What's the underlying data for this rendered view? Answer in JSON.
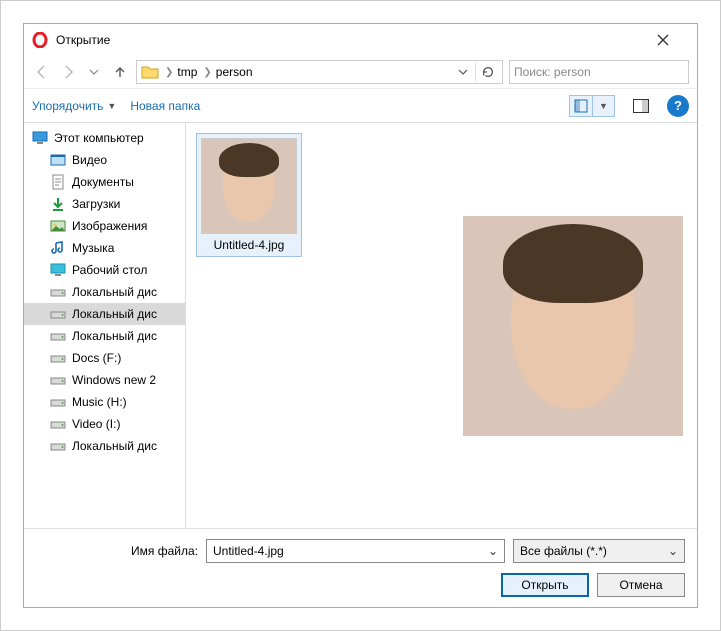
{
  "title": "Открытие",
  "breadcrumbs": [
    "tmp",
    "person"
  ],
  "search_placeholder": "Поиск: person",
  "toolbar": {
    "organize_label": "Упорядочить",
    "newfolder_label": "Новая папка",
    "help_glyph": "?"
  },
  "tree": {
    "root": "Этот компьютер",
    "items": [
      {
        "label": "Видео",
        "icon": "video"
      },
      {
        "label": "Документы",
        "icon": "docs"
      },
      {
        "label": "Загрузки",
        "icon": "downloads"
      },
      {
        "label": "Изображения",
        "icon": "images"
      },
      {
        "label": "Музыка",
        "icon": "music"
      },
      {
        "label": "Рабочий стол",
        "icon": "desktop"
      },
      {
        "label": "Локальный дис",
        "icon": "drive"
      },
      {
        "label": "Локальный дис",
        "icon": "drive",
        "selected": true
      },
      {
        "label": "Локальный дис",
        "icon": "drive"
      },
      {
        "label": "Docs (F:)",
        "icon": "drive"
      },
      {
        "label": "Windows new 2",
        "icon": "drive"
      },
      {
        "label": "Music (H:)",
        "icon": "drive"
      },
      {
        "label": "Video (I:)",
        "icon": "drive"
      },
      {
        "label": "Локальный дис",
        "icon": "drive"
      }
    ]
  },
  "file": {
    "name": "Untitled-4.jpg"
  },
  "footer": {
    "filename_label": "Имя файла:",
    "filename_value": "Untitled-4.jpg",
    "filter_label": "Все файлы (*.*)",
    "open_label": "Открыть",
    "cancel_label": "Отмена"
  }
}
